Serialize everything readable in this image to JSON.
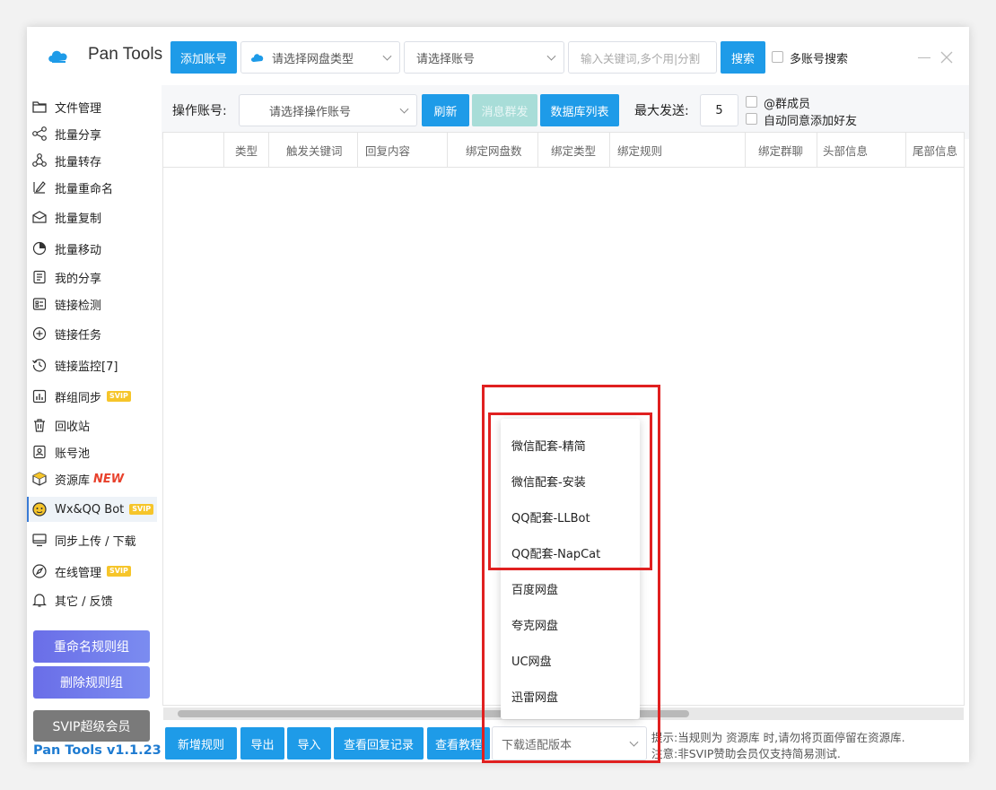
{
  "app": {
    "title": "Pan Tools",
    "version": "Pan Tools v1.1.23"
  },
  "topbar": {
    "add_account": "添加账号",
    "disk_type_placeholder": "请选择网盘类型",
    "account_placeholder": "请选择账号",
    "search_placeholder": "输入关键词,多个用|分割",
    "search_button": "搜索",
    "multi_account_search": "多账号搜索"
  },
  "sidebar": {
    "items": [
      {
        "label": "文件管理",
        "icon": "folder-icon"
      },
      {
        "label": "批量分享",
        "icon": "share-icon"
      },
      {
        "label": "批量转存",
        "icon": "transfer-icon"
      },
      {
        "label": "批量重命名",
        "icon": "rename-icon"
      },
      {
        "label": "批量复制",
        "icon": "copy-icon"
      },
      {
        "label": "批量移动",
        "icon": "move-icon"
      },
      {
        "label": "我的分享",
        "icon": "my-share-icon"
      },
      {
        "label": "链接检测",
        "icon": "link-check-icon"
      },
      {
        "label": "链接任务",
        "icon": "link-task-icon"
      },
      {
        "label": "链接监控[7]",
        "icon": "link-monitor-icon"
      },
      {
        "label": "群组同步",
        "icon": "group-sync-icon",
        "badge": "SVIP"
      },
      {
        "label": "回收站",
        "icon": "trash-icon"
      },
      {
        "label": "账号池",
        "icon": "account-pool-icon"
      },
      {
        "label": "资源库",
        "icon": "resource-library-icon",
        "badge": "NEW"
      },
      {
        "label": "Wx&QQ Bot",
        "icon": "bot-icon",
        "badge": "SVIP"
      },
      {
        "label": "同步上传 / 下载",
        "icon": "sync-upload-icon"
      },
      {
        "label": "在线管理",
        "icon": "compass-icon",
        "badge": "SVIP"
      },
      {
        "label": "其它 / 反馈",
        "icon": "bell-icon"
      }
    ],
    "rename_rule_group": "重命名规则组",
    "delete_rule_group": "删除规则组",
    "svip_member": "SVIP超级会员"
  },
  "toolbar": {
    "operate_account_label": "操作账号:",
    "operate_account_placeholder": "请选择操作账号",
    "refresh": "刷新",
    "mass_message": "消息群发",
    "database_list": "数据库列表",
    "max_send_label": "最大发送:",
    "max_send_value": "5",
    "group_members": "@群成员",
    "auto_accept_friends": "自动同意添加好友"
  },
  "table": {
    "columns": [
      "类型",
      "触发关键词",
      "回复内容",
      "绑定网盘数",
      "绑定类型",
      "绑定规则",
      "绑定群聊",
      "头部信息",
      "尾部信息"
    ]
  },
  "dropdown": {
    "options": [
      "微信配套-精简",
      "微信配套-安装",
      "QQ配套-LLBot",
      "QQ配套-NapCat",
      "百度网盘",
      "夸克网盘",
      "UC网盘",
      "迅雷网盘"
    ]
  },
  "bottombar": {
    "new_rule": "新增规则",
    "export": "导出",
    "import": "导入",
    "view_reply_log": "查看回复记录",
    "view_tutorial": "查看教程",
    "download_version_placeholder": "下载适配版本",
    "hint_line1": "提示:当规则为 资源库 时,请勿将页面停留在资源库.",
    "hint_line2": "注意:非SVIP赞助会员仅支持简易测试."
  },
  "colors": {
    "primary": "#1e9be8",
    "primary_disabled": "#a8ddd8",
    "purple_gradient_start": "#6a6ee8",
    "purple_gradient_end": "#7b8cf0",
    "svip_button": "#7a7a7a",
    "version_text": "#1e7bd1",
    "highlight_red": "#e02020",
    "svip_badge": "#f6c52a",
    "new_badge": "#e8412c"
  }
}
